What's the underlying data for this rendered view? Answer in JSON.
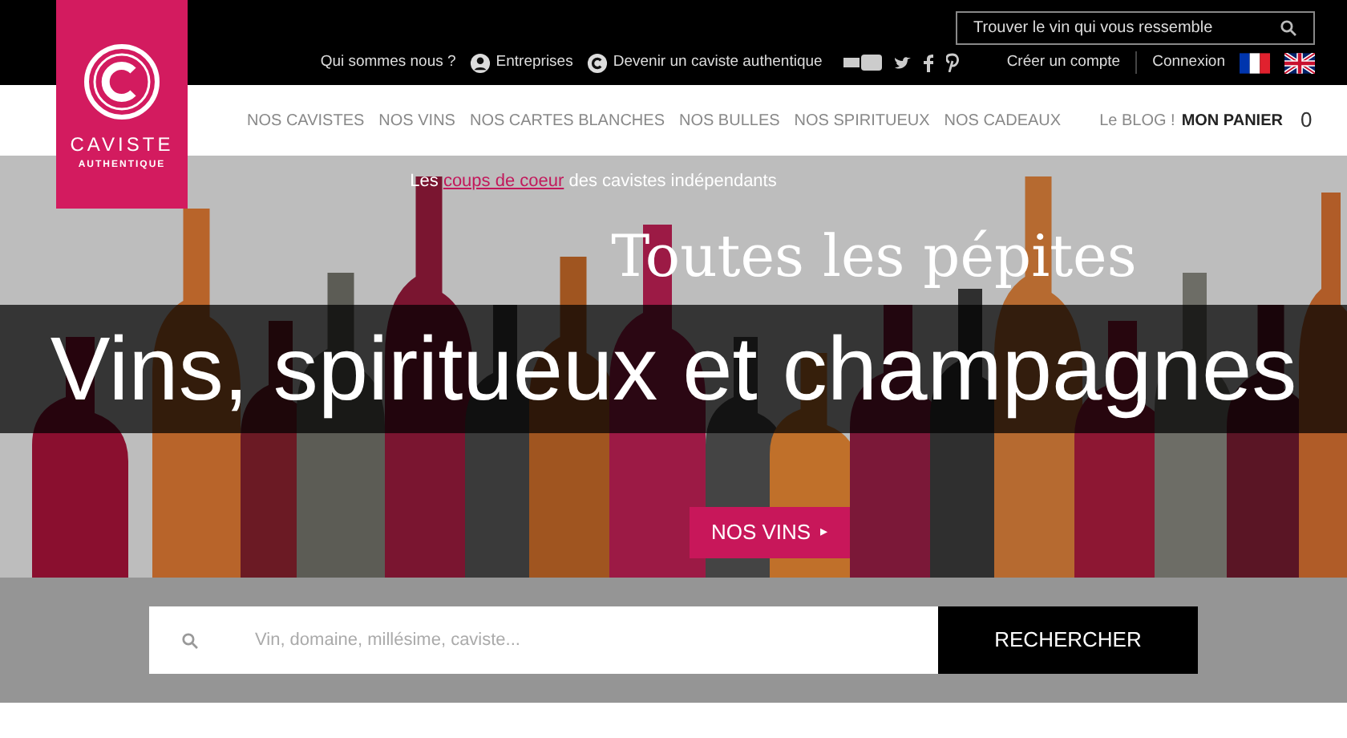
{
  "top_bar": {
    "search": {
      "placeholder": "Trouver le vin qui vous ressemble"
    },
    "links": [
      {
        "label": "Qui sommes nous ?",
        "kind": "plain"
      },
      {
        "label": "Entreprises",
        "kind": "person"
      },
      {
        "label": "Devenir un caviste authentique",
        "kind": "logo"
      }
    ],
    "account_links": [
      "Créer un compte",
      "Connexion"
    ]
  },
  "logo": {
    "name": "CAVISTE",
    "tagline": "AUTHENTIQUE"
  },
  "nav": {
    "items": [
      "NOS CAVISTES",
      "NOS VINS",
      "NOS CARTES BLANCHES",
      "NOS BULLES",
      "NOS SPIRITUEUX",
      "NOS CADEAUX"
    ],
    "blog": "Le BLOG !",
    "cart_label": "MON PANIER",
    "cart_count": "0"
  },
  "hero": {
    "tagline_link": "coups de coeur",
    "tagline_before": "Les",
    "tagline_after": "des cavistes indépendants",
    "title_top": "Toutes les pépites",
    "button": "NOS VINS",
    "button_arrow": "▸"
  },
  "banner": "Vins, spiritueux et champagnes",
  "search": {
    "placeholder": "Vin, domaine, millésime, caviste...",
    "button": "RECHERCHER"
  }
}
